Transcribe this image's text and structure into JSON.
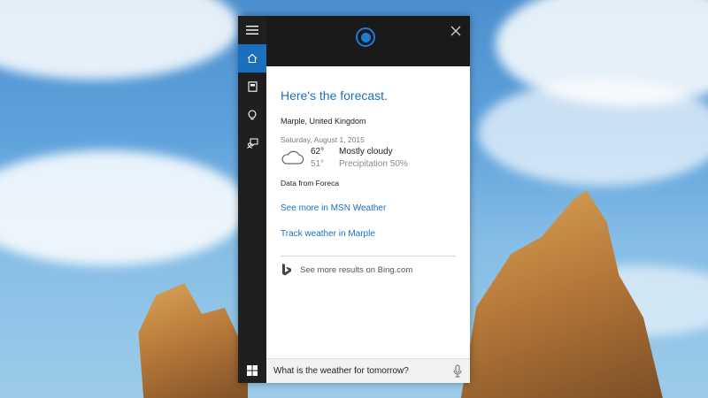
{
  "colors": {
    "accent": "#1a6fbf",
    "rail": "#1f1f1f",
    "topbar": "#1a1a1a"
  },
  "rail": {
    "items": [
      {
        "icon": "home-icon",
        "active": true
      },
      {
        "icon": "notebook-icon",
        "active": false
      },
      {
        "icon": "lightbulb-icon",
        "active": false
      },
      {
        "icon": "feedback-icon",
        "active": false
      }
    ]
  },
  "card": {
    "headline": "Here's the forecast.",
    "location": "Marple, United Kingdom",
    "date": "Saturday, August 1, 2015",
    "weather_icon": "cloudy-icon",
    "high": "62°",
    "low": "51°",
    "condition": "Mostly cloudy",
    "precipitation": "Precipitation 50%",
    "source": "Data from Foreca",
    "link_msn": "See more in MSN Weather",
    "link_track": "Track weather in Marple",
    "bing_text": "See more results on Bing.com"
  },
  "search": {
    "query": "What is the weather for tomorrow?",
    "mic_icon": "microphone-icon"
  }
}
